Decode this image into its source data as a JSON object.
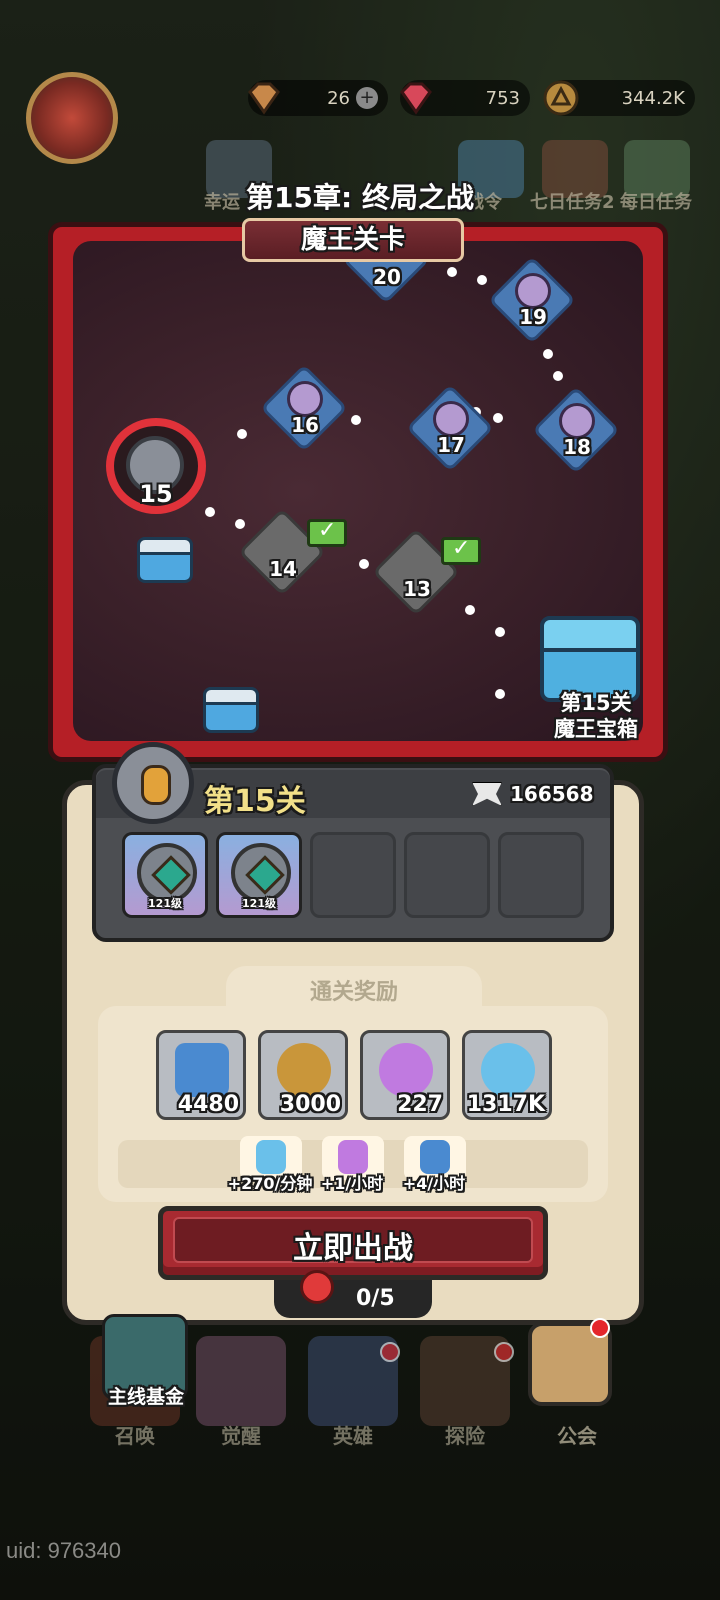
{
  "resources": [
    {
      "name": "gem",
      "value": "26"
    },
    {
      "name": "ruby",
      "value": "753"
    },
    {
      "name": "coin",
      "value": "344.2K"
    }
  ],
  "top_icons": [
    {
      "label": "幸运"
    },
    {
      "label": "战令"
    },
    {
      "label": "七日任务2"
    },
    {
      "label": "每日任务"
    }
  ],
  "chapter_title": "第15章: 终局之战",
  "map": {
    "banner": "魔王关卡",
    "stages": [
      "15",
      "16",
      "17",
      "18",
      "19",
      "20",
      "14",
      "13"
    ],
    "boss_chest_label": [
      "第15关",
      "魔王宝箱"
    ]
  },
  "stage": {
    "name": "第15关",
    "power": "166568",
    "enemies": [
      {
        "level": "121级"
      },
      {
        "level": "121级"
      }
    ]
  },
  "rewards": {
    "title": "通关奖励",
    "items": [
      {
        "icon": "crystal-icon",
        "amount": "4480"
      },
      {
        "icon": "coin-icon",
        "amount": "3000"
      },
      {
        "icon": "purple-potion-icon",
        "amount": "227"
      },
      {
        "icon": "blue-potion-icon",
        "amount": "1317K"
      }
    ],
    "rates": [
      {
        "icon": "blue-potion-icon",
        "label": "+270/分钟"
      },
      {
        "icon": "purple-potion-icon",
        "label": "+1/小时"
      },
      {
        "icon": "crystal-icon",
        "label": "+4/小时"
      }
    ]
  },
  "battle_button": "立即出战",
  "stamina": "0/5",
  "fund_label": "主线基金",
  "nav": [
    {
      "label": "召唤"
    },
    {
      "label": "觉醒"
    },
    {
      "label": "英雄"
    },
    {
      "label": "探险"
    },
    {
      "label": "公会"
    }
  ],
  "uid": "uid: 976340",
  "colors": {
    "map_border": "#b51f26",
    "panel_bg": "#e9dcc0",
    "button": "#a82a31",
    "stage_name": "#f2e089"
  }
}
